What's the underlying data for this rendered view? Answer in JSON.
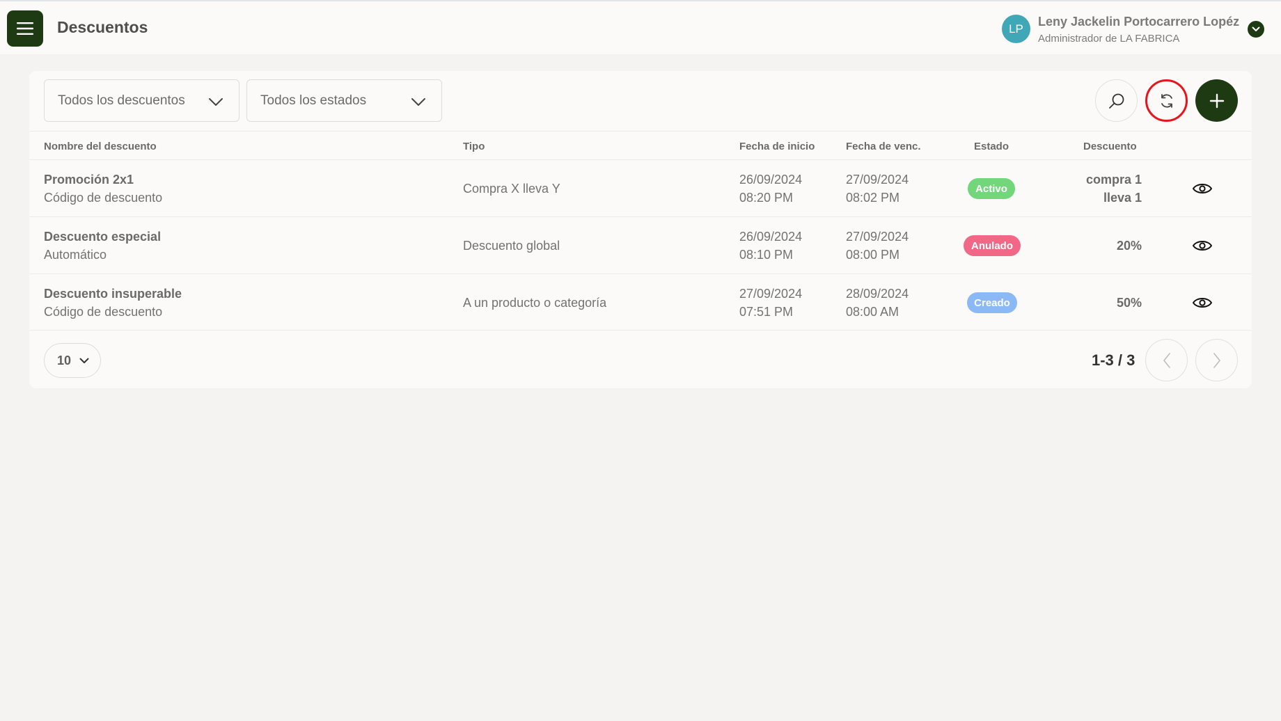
{
  "header": {
    "title": "Descuentos",
    "user": {
      "initials": "LP",
      "name": "Leny Jackelin Portocarrero Lopéz",
      "role": "Administrador de LA FABRICA"
    }
  },
  "filters": {
    "discount_filter": "Todos los descuentos",
    "status_filter": "Todos los estados"
  },
  "table": {
    "columns": [
      "Nombre del descuento",
      "Tipo",
      "Fecha de inicio",
      "Fecha de venc.",
      "Estado",
      "Descuento"
    ],
    "rows": [
      {
        "name": "Promoción 2x1",
        "method": "Código de descuento",
        "type": "Compra X lleva Y",
        "start_date": "26/09/2024",
        "start_time": "08:20 PM",
        "end_date": "27/09/2024",
        "end_time": "08:02 PM",
        "status": "Activo",
        "status_color": "#72d67b",
        "discount_line1": "compra 1",
        "discount_line2": "lleva 1"
      },
      {
        "name": "Descuento especial",
        "method": "Automático",
        "type": "Descuento global",
        "start_date": "26/09/2024",
        "start_time": "08:10 PM",
        "end_date": "27/09/2024",
        "end_time": "08:00 PM",
        "status": "Anulado",
        "status_color": "#f06886",
        "discount_line1": "20%",
        "discount_line2": ""
      },
      {
        "name": "Descuento insuperable",
        "method": "Código de descuento",
        "type": "A un producto o categoría",
        "start_date": "27/09/2024",
        "start_time": "07:51 PM",
        "end_date": "28/09/2024",
        "end_time": "08:00 AM",
        "status": "Creado",
        "status_color": "#8ab9f5",
        "discount_line1": "50%",
        "discount_line2": ""
      }
    ]
  },
  "pagination": {
    "page_size": "10",
    "range": "1-3 / 3"
  },
  "icons": {
    "menu": "hamburger-icon",
    "search": "search-icon",
    "refresh": "refresh-icon",
    "add": "plus-icon",
    "view": "eye-icon",
    "prev": "chevron-left-icon",
    "next": "chevron-right-icon"
  },
  "colors": {
    "primary": "#1e3a12",
    "avatar": "#3fa7b6",
    "highlight": "#e8131b"
  }
}
